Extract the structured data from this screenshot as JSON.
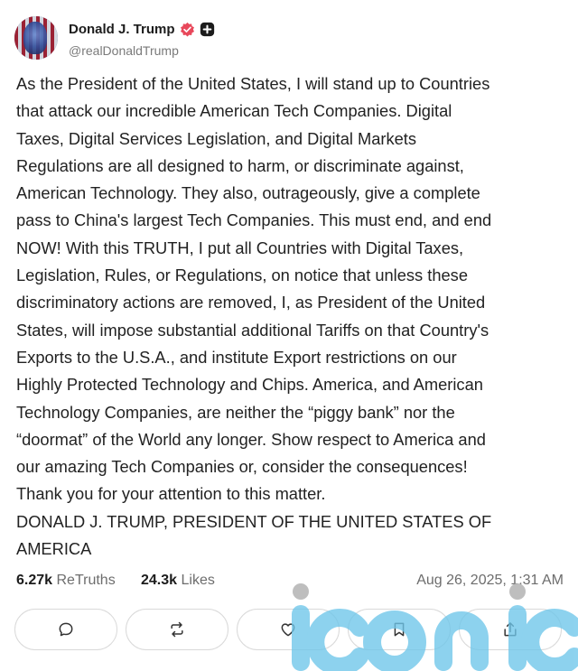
{
  "author": {
    "display_name": "Donald J. Trump",
    "handle": "@realDonaldTrump",
    "verified_icon": "verified-badge-icon",
    "plus_icon": "plus-badge-icon"
  },
  "post": {
    "text": "As the President of the United States, I will stand up to Countries\nthat attack our incredible American Tech Companies. Digital\nTaxes, Digital Services Legislation, and Digital Markets\nRegulations are all designed to harm, or discriminate against,\nAmerican Technology. They also, outrageously, give a complete\npass to China's largest Tech Companies. This must end, and end\nNOW! With this TRUTH, I put all Countries with Digital Taxes,\nLegislation, Rules, or Regulations, on notice that unless these\ndiscriminatory actions are removed, I, as President of the United\nStates, will impose substantial additional Tariffs on that Country's\nExports to the U.S.A., and institute Export restrictions on our\nHighly Protected Technology and Chips. America, and American\nTechnology Companies, are neither the “piggy bank” nor the\n“doormat” of the World any longer. Show respect to America and\nour amazing Tech Companies or, consider the consequences!\nThank you for your attention to this matter.\nDONALD J. TRUMP, PRESIDENT OF THE UNITED STATES OF\nAMERICA"
  },
  "stats": {
    "retruths_count": "6.27k",
    "retruths_label": "ReTruths",
    "likes_count": "24.3k",
    "likes_label": "Likes",
    "timestamp": "Aug 26, 2025, 1:31 AM"
  },
  "actions": [
    {
      "name": "reply",
      "icon": "reply-icon"
    },
    {
      "name": "retruth",
      "icon": "retruth-icon"
    },
    {
      "name": "like",
      "icon": "heart-icon"
    },
    {
      "name": "bookmark",
      "icon": "bookmark-icon"
    },
    {
      "name": "share",
      "icon": "share-icon"
    }
  ],
  "watermark": {
    "text": "iconic",
    "color": "#6ec6ea"
  },
  "colors": {
    "verified": "#e8485b",
    "text": "#222222",
    "muted": "#6d6d6d",
    "border": "#d9d9d9"
  }
}
